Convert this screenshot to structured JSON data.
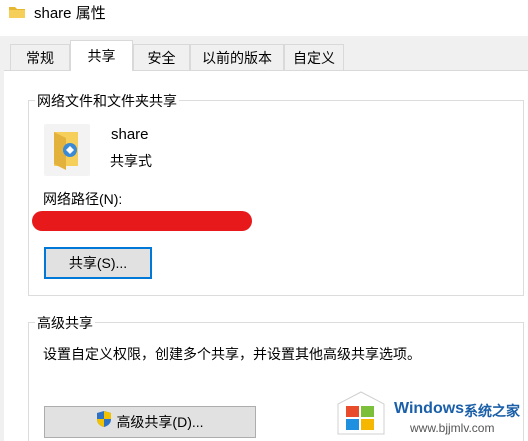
{
  "window": {
    "title": "share 属性"
  },
  "tabs": [
    {
      "label": "常规"
    },
    {
      "label": "共享"
    },
    {
      "label": "安全"
    },
    {
      "label": "以前的版本"
    },
    {
      "label": "自定义"
    }
  ],
  "network_sharing": {
    "group_title": "网络文件和文件夹共享",
    "folder_name": "share",
    "share_status": "共享式",
    "path_label": "网络路径(N):",
    "share_button": "共享(S)..."
  },
  "advanced_sharing": {
    "group_title": "高级共享",
    "description": "设置自定义权限，创建多个共享，并设置其他高级共享选项。",
    "button": "高级共享(D)..."
  },
  "watermark": {
    "brand": "Windows",
    "brand_cn": "系统之家",
    "url": "www.bjjmlv.com"
  },
  "colors": {
    "accent": "#0078d7",
    "redaction": "#e8191b",
    "watermark_brand": "#1a5fa8"
  }
}
